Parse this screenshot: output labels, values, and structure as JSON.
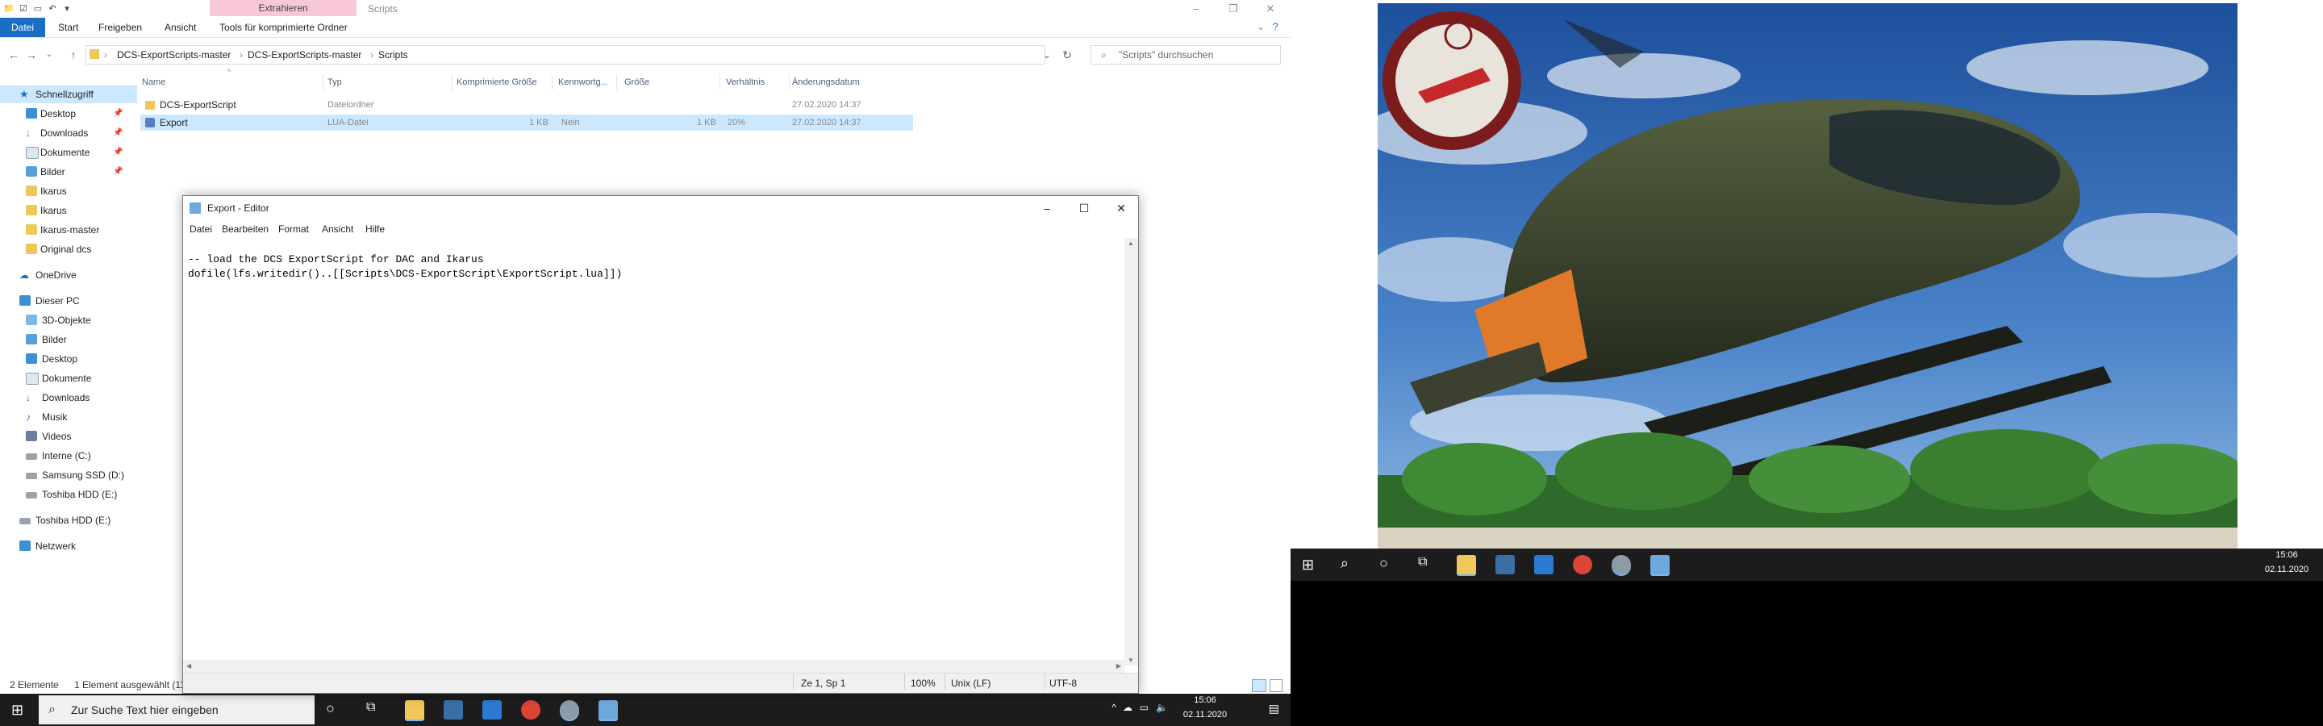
{
  "explorer": {
    "title": "Scripts",
    "context_tab": "Extrahieren",
    "ribbon_tabs": [
      "Datei",
      "Start",
      "Freigeben",
      "Ansicht",
      "Tools für komprimierte Ordner"
    ],
    "breadcrumb": [
      "DCS-ExportScripts-master",
      "DCS-ExportScripts-master",
      "Scripts"
    ],
    "search_placeholder": "\"Scripts\" durchsuchen",
    "nav": {
      "quick_access": "Schnellzugriff",
      "items": [
        "Desktop",
        "Downloads",
        "Dokumente",
        "Bilder",
        "Ikarus",
        "Ikarus",
        "Ikarus-master",
        "Original dcs"
      ],
      "onedrive": "OneDrive",
      "this_pc": "Dieser PC",
      "pc_items": [
        "3D-Objekte",
        "Bilder",
        "Desktop",
        "Dokumente",
        "Downloads",
        "Musik",
        "Videos",
        "Interne (C:)",
        "Samsung SSD (D:)",
        "Toshiba HDD (E:)"
      ],
      "toshiba": "Toshiba HDD (E:)",
      "network": "Netzwerk"
    },
    "columns": [
      "Name",
      "Typ",
      "Komprimierte Größe",
      "Kennwortg...",
      "Größe",
      "Verhältnis",
      "Änderungsdatum"
    ],
    "files": [
      {
        "name": "DCS-ExportScript",
        "type": "Dateiordner",
        "csize": "",
        "pw": "",
        "size": "",
        "ratio": "",
        "date": "27.02.2020 14:37"
      },
      {
        "name": "Export",
        "type": "LUA-Datei",
        "csize": "1 KB",
        "pw": "Nein",
        "size": "1 KB",
        "ratio": "20%",
        "date": "27.02.2020 14:37"
      }
    ],
    "status_count": "2 Elemente",
    "status_selected": "1 Element ausgewählt (11"
  },
  "notepad": {
    "title": "Export - Editor",
    "menu": [
      "Datei",
      "Bearbeiten",
      "Format",
      "Ansicht",
      "Hilfe"
    ],
    "line1": "-- load the DCS ExportScript for DAC and Ikarus",
    "line2": "dofile(lfs.writedir()..[[Scripts\\DCS-ExportScript\\ExportScript.lua]])",
    "status": {
      "pos": "Ze 1, Sp 1",
      "zoom": "100%",
      "eol": "Unix (LF)",
      "enc": "UTF-8"
    }
  },
  "taskbar1": {
    "search": "Zur Suche Text hier eingeben",
    "time": "15:06",
    "date": "02.11.2020"
  },
  "taskbar2": {
    "time": "15:06",
    "date": "02.11.2020"
  },
  "colors": {
    "accent": "#1a6fc4",
    "selection": "#cce8ff",
    "taskbar": "#1c1c1c",
    "context_tab": "#f8c8d8"
  }
}
